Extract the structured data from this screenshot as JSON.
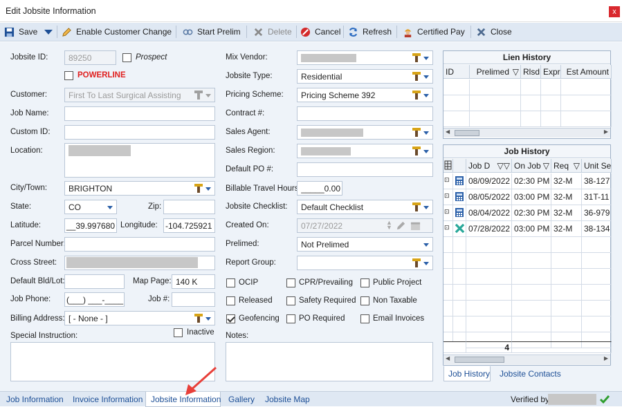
{
  "window": {
    "title": "Edit Jobsite Information",
    "close_glyph": "x"
  },
  "toolbar": {
    "save": "Save",
    "enable_customer_change": "Enable Customer Change",
    "start_prelim": "Start Prelim",
    "delete": "Delete",
    "cancel": "Cancel",
    "refresh": "Refresh",
    "certified_pay": "Certified Pay",
    "close": "Close"
  },
  "left": {
    "jobsite_id_label": "Jobsite ID:",
    "jobsite_id": "89250",
    "prospect": "Prospect",
    "powerline": "POWERLINE",
    "customer_label": "Customer:",
    "customer": "First To Last Surgical Assisting",
    "job_name_label": "Job Name:",
    "custom_id_label": "Custom ID:",
    "location_label": "Location:",
    "city_label": "City/Town:",
    "city": "BRIGHTON",
    "state_label": "State:",
    "state": "CO",
    "zip_label": "Zip:",
    "latitude_label": "Latitude:",
    "latitude": "__39.997680",
    "longitude_label": "Longitude:",
    "longitude": "-104.725921",
    "parcel_label": "Parcel Number:",
    "cross_street_label": "Cross Street:",
    "default_bld_label": "Default Bld/Lot:",
    "map_page_label": "Map Page:",
    "map_page": "140 K",
    "job_phone_label": "Job Phone:",
    "job_phone": "(___) ___-____",
    "job_no_label": "Job #:",
    "billing_label": "Billing Address:",
    "billing": "[ - None - ]",
    "inactive": "Inactive",
    "special_label": "Special Instruction:"
  },
  "middle": {
    "mix_vendor_label": "Mix Vendor:",
    "jobsite_type_label": "Jobsite Type:",
    "jobsite_type": "Residential",
    "pricing_label": "Pricing Scheme:",
    "pricing": "Pricing Scheme 392",
    "contract_label": "Contract #:",
    "sales_agent_label": "Sales Agent:",
    "sales_region_label": "Sales Region:",
    "default_po_label": "Default PO #:",
    "billable_label": "Billable Travel Hours:",
    "billable": "_____0.00",
    "checklist_label": "Jobsite Checklist:",
    "checklist": "Default Checklist",
    "created_label": "Created On:",
    "created": "07/27/2022",
    "prelimed_label": "Prelimed:",
    "prelimed": "Not Prelimed",
    "report_group_label": "Report Group:",
    "notes_label": "Notes:",
    "checks": [
      {
        "label": "OCIP",
        "checked": false
      },
      {
        "label": "CPR/Prevailing",
        "checked": false
      },
      {
        "label": "Public Project",
        "checked": false
      },
      {
        "label": "Released",
        "checked": false
      },
      {
        "label": "Safety Required",
        "checked": false
      },
      {
        "label": "Non Taxable",
        "checked": false
      },
      {
        "label": "Geofencing",
        "checked": true
      },
      {
        "label": "PO Required",
        "checked": false
      },
      {
        "label": "Email Invoices",
        "checked": false
      }
    ]
  },
  "lien_history": {
    "title": "Lien History",
    "columns": [
      "ID",
      "Prelimed",
      "Rlsd",
      "Expr",
      "Est Amount"
    ]
  },
  "job_history": {
    "title": "Job History",
    "columns": [
      "Job D",
      "On Job",
      "Req",
      "Unit Se"
    ],
    "rows": [
      {
        "date": "08/09/2022",
        "time": "02:30 PM",
        "req": "32-M",
        "unit": "38-127",
        "icon": "calculator-icon"
      },
      {
        "date": "08/05/2022",
        "time": "03:00 PM",
        "req": "32-M",
        "unit": "31T-11",
        "icon": "calculator-icon"
      },
      {
        "date": "08/04/2022",
        "time": "02:30 PM",
        "req": "32-M",
        "unit": "36-979",
        "icon": "calculator-icon"
      },
      {
        "date": "07/28/2022",
        "time": "03:00 PM",
        "req": "32-M",
        "unit": "38-134",
        "icon": "cancel-x-icon"
      }
    ],
    "total": "4",
    "tabs": [
      "Job History",
      "Jobsite Contacts"
    ]
  },
  "bottom_tabs": [
    "Job Information",
    "Invoice Information",
    "Jobsite Information",
    "Gallery",
    "Jobsite Map"
  ],
  "verified_by": "Verified by",
  "colors": {
    "accent": "#2a5fa8",
    "powerline": "#e0201f",
    "toolbar": "#dfe8f3",
    "arrow": "#e8403a"
  }
}
